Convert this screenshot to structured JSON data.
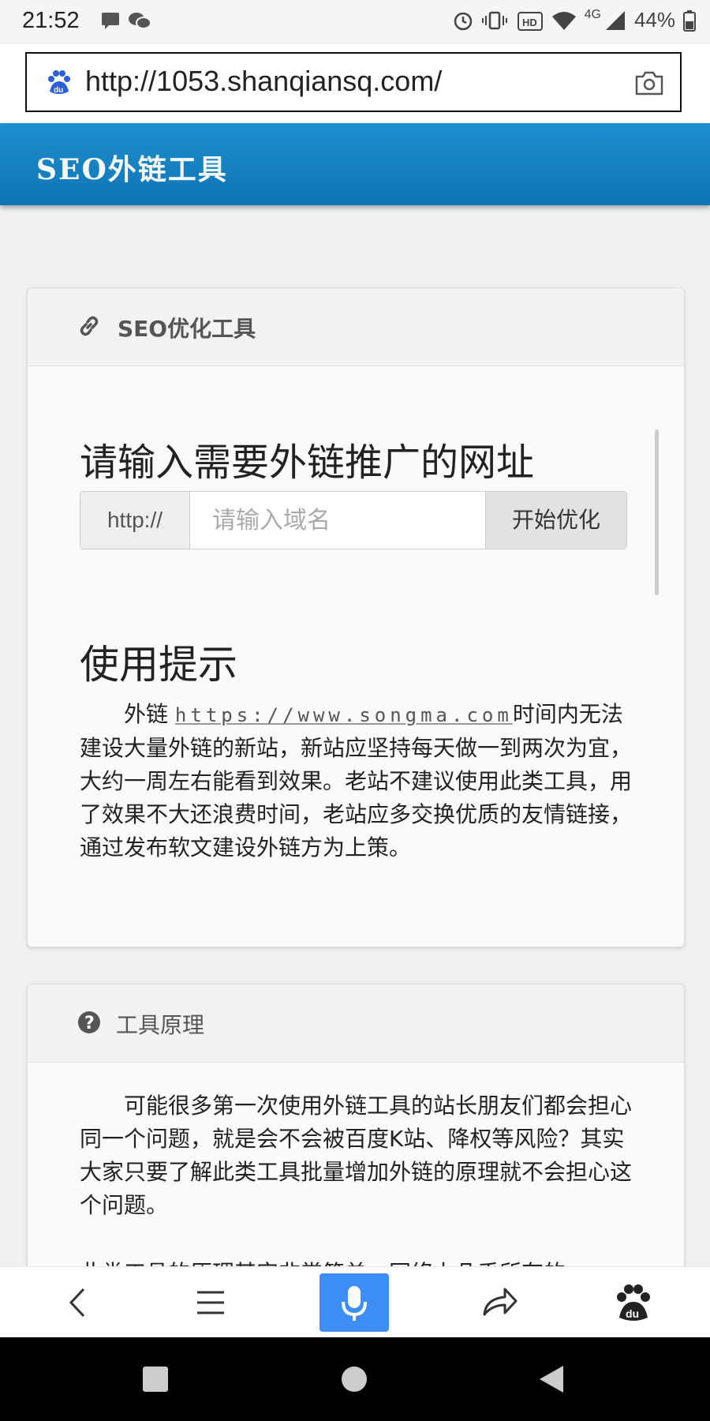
{
  "status_bar": {
    "time": "21:52",
    "network": "4G",
    "battery": "44%"
  },
  "browser": {
    "url": "http://1053.shanqiansq.com/"
  },
  "site": {
    "brand": "SEO外链工具"
  },
  "panel_tool": {
    "title": "SEO优化工具",
    "heading": "请输入需要外链推广的网址",
    "prefix": "http://",
    "input_placeholder": "请输入域名",
    "input_value": "",
    "submit_label": "开始优化"
  },
  "tips": {
    "heading": "使用提示",
    "para_start": "外链",
    "watermark": "https://www.songma.com",
    "para_rest": "时间内无法建设大量外链的新站，新站应坚持每天做一到两次为宜，大约一周左右能看到效果。老站不建议使用此类工具，用了效果不大还浪费时间，老站应多交换优质的友情链接，通过发布软文建设外链方为上策。"
  },
  "panel_principle": {
    "title": "工具原理",
    "para1": "可能很多第一次使用外链工具的站长朋友们都会担心同一个问题，就是会不会被百度K站、降权等风险？其实大家只要了解此类工具批量增加外链的原理就不会担心这个问题。",
    "para2": "此类工具的原理其实非常简单，网络上几乎所有的"
  },
  "icons": {
    "accent": "#1a85c6",
    "mic_bg": "#3d8ef7"
  }
}
